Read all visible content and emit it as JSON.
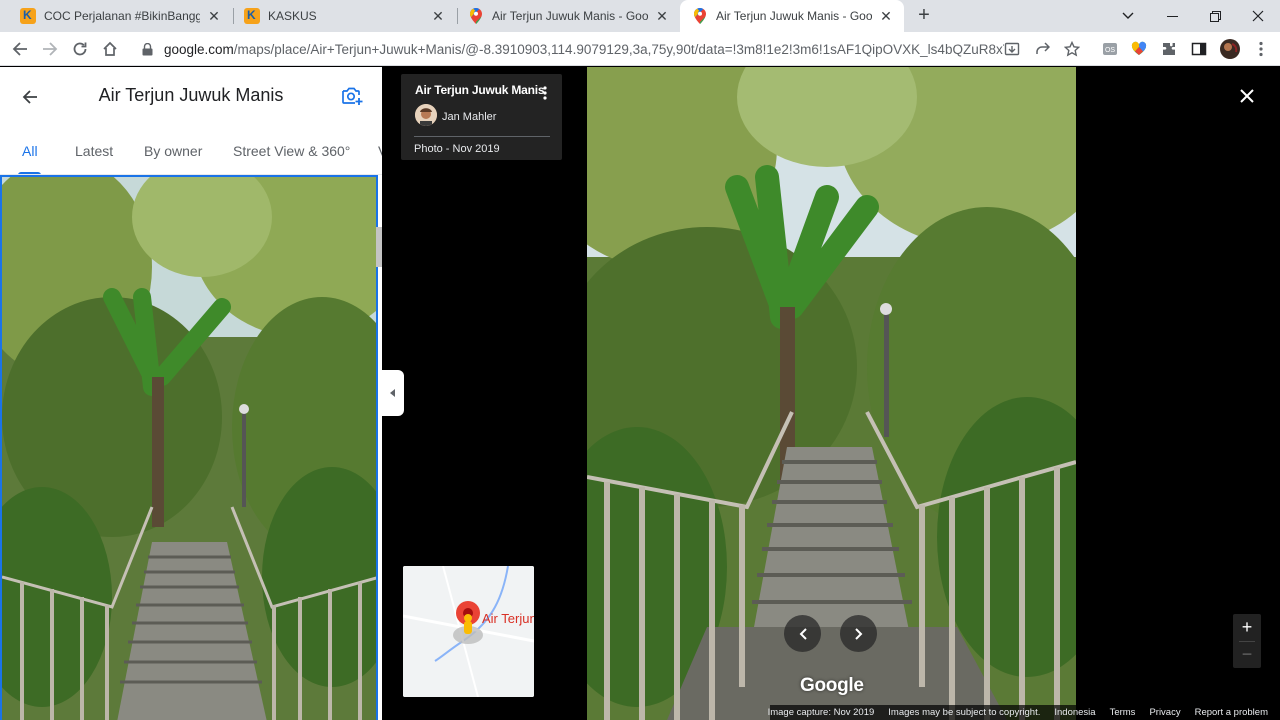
{
  "browser": {
    "tabs": [
      {
        "title": "COC Perjalanan #BikinBanggaInd",
        "favicon": "kaskus-icon",
        "active": false
      },
      {
        "title": "KASKUS",
        "favicon": "kaskus-icon",
        "active": false
      },
      {
        "title": "Air Terjun Juwuk Manis - Google",
        "favicon": "google-maps-pin-icon",
        "active": false
      },
      {
        "title": "Air Terjun Juwuk Manis - Google",
        "favicon": "google-maps-pin-icon",
        "active": true
      }
    ],
    "url_host": "google.com",
    "url_path": "/maps/place/Air+Terjun+Juwuk+Manis/@-8.3910903,114.9079129,3a,75y,90t/data=!3m8!1e2!3m6!1sAF1QipOVXK_ls4bQZuR8xTR..."
  },
  "left_panel": {
    "title": "Air Terjun Juwuk Manis",
    "tabs": [
      {
        "label": "All",
        "active": true
      },
      {
        "label": "Latest",
        "active": false
      },
      {
        "label": "By owner",
        "active": false
      },
      {
        "label": "Street View & 360°",
        "active": false
      },
      {
        "label": "V",
        "active": false
      }
    ]
  },
  "viewer": {
    "info_card": {
      "place_name": "Air Terjun Juwuk Manis",
      "author": "Jan Mahler",
      "date": "Photo - Nov 2019"
    },
    "minimap": {
      "label": "Air Terjun Juwuk Manis"
    },
    "logo": "Google",
    "zoom_in": "+",
    "zoom_out": "−",
    "footer": {
      "capture": "Image capture: Nov 2019",
      "copyright": "Images may be subject to copyright.",
      "country": "Indonesia",
      "terms": "Terms",
      "privacy": "Privacy",
      "report": "Report a problem"
    }
  },
  "colors": {
    "accent": "#1a73e8",
    "pin": "#d93025"
  }
}
